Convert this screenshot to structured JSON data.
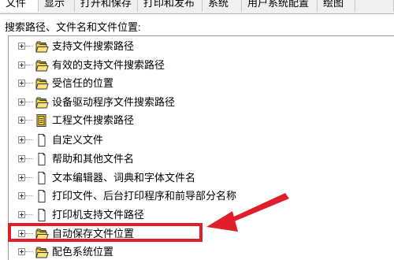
{
  "tabs": [
    {
      "label": "文件",
      "active": true
    },
    {
      "label": "显示",
      "active": false
    },
    {
      "label": "打开和保存",
      "active": false
    },
    {
      "label": "打印和发布",
      "active": false
    },
    {
      "label": "系统",
      "active": false
    },
    {
      "label": "用户系统配置",
      "active": false
    },
    {
      "label": "绘图",
      "active": false
    },
    {
      "label": "",
      "active": false
    }
  ],
  "section_label": "搜索路径、文件名和文件位置:",
  "tree_items": [
    {
      "label": "支持文件搜索路径",
      "icon": "folder-stack-icon"
    },
    {
      "label": "有效的支持文件搜索路径",
      "icon": "folder-stack-icon"
    },
    {
      "label": "受信任的位置",
      "icon": "folder-stack-icon"
    },
    {
      "label": "设备驱动程序文件搜索路径",
      "icon": "folder-stack-icon"
    },
    {
      "label": "工程文件搜索路径",
      "icon": "project-file-icon"
    },
    {
      "label": "自定义文件",
      "icon": "document-icon"
    },
    {
      "label": "帮助和其他文件名",
      "icon": "document-icon"
    },
    {
      "label": "文本编辑器、词典和字体文件名",
      "icon": "document-icon"
    },
    {
      "label": "打印文件、后台打印程序和前导部分名称",
      "icon": "document-icon"
    },
    {
      "label": "打印机支持文件路径",
      "icon": "document-icon"
    },
    {
      "label": "自动保存文件位置",
      "icon": "folder-stack-icon"
    },
    {
      "label": "配色系统位置",
      "icon": "folder-stack-icon"
    }
  ],
  "colors": {
    "annotation_red": "#e11d2b",
    "folder_yellow": "#f6d23a",
    "folder_outline": "#3a3a3a"
  }
}
